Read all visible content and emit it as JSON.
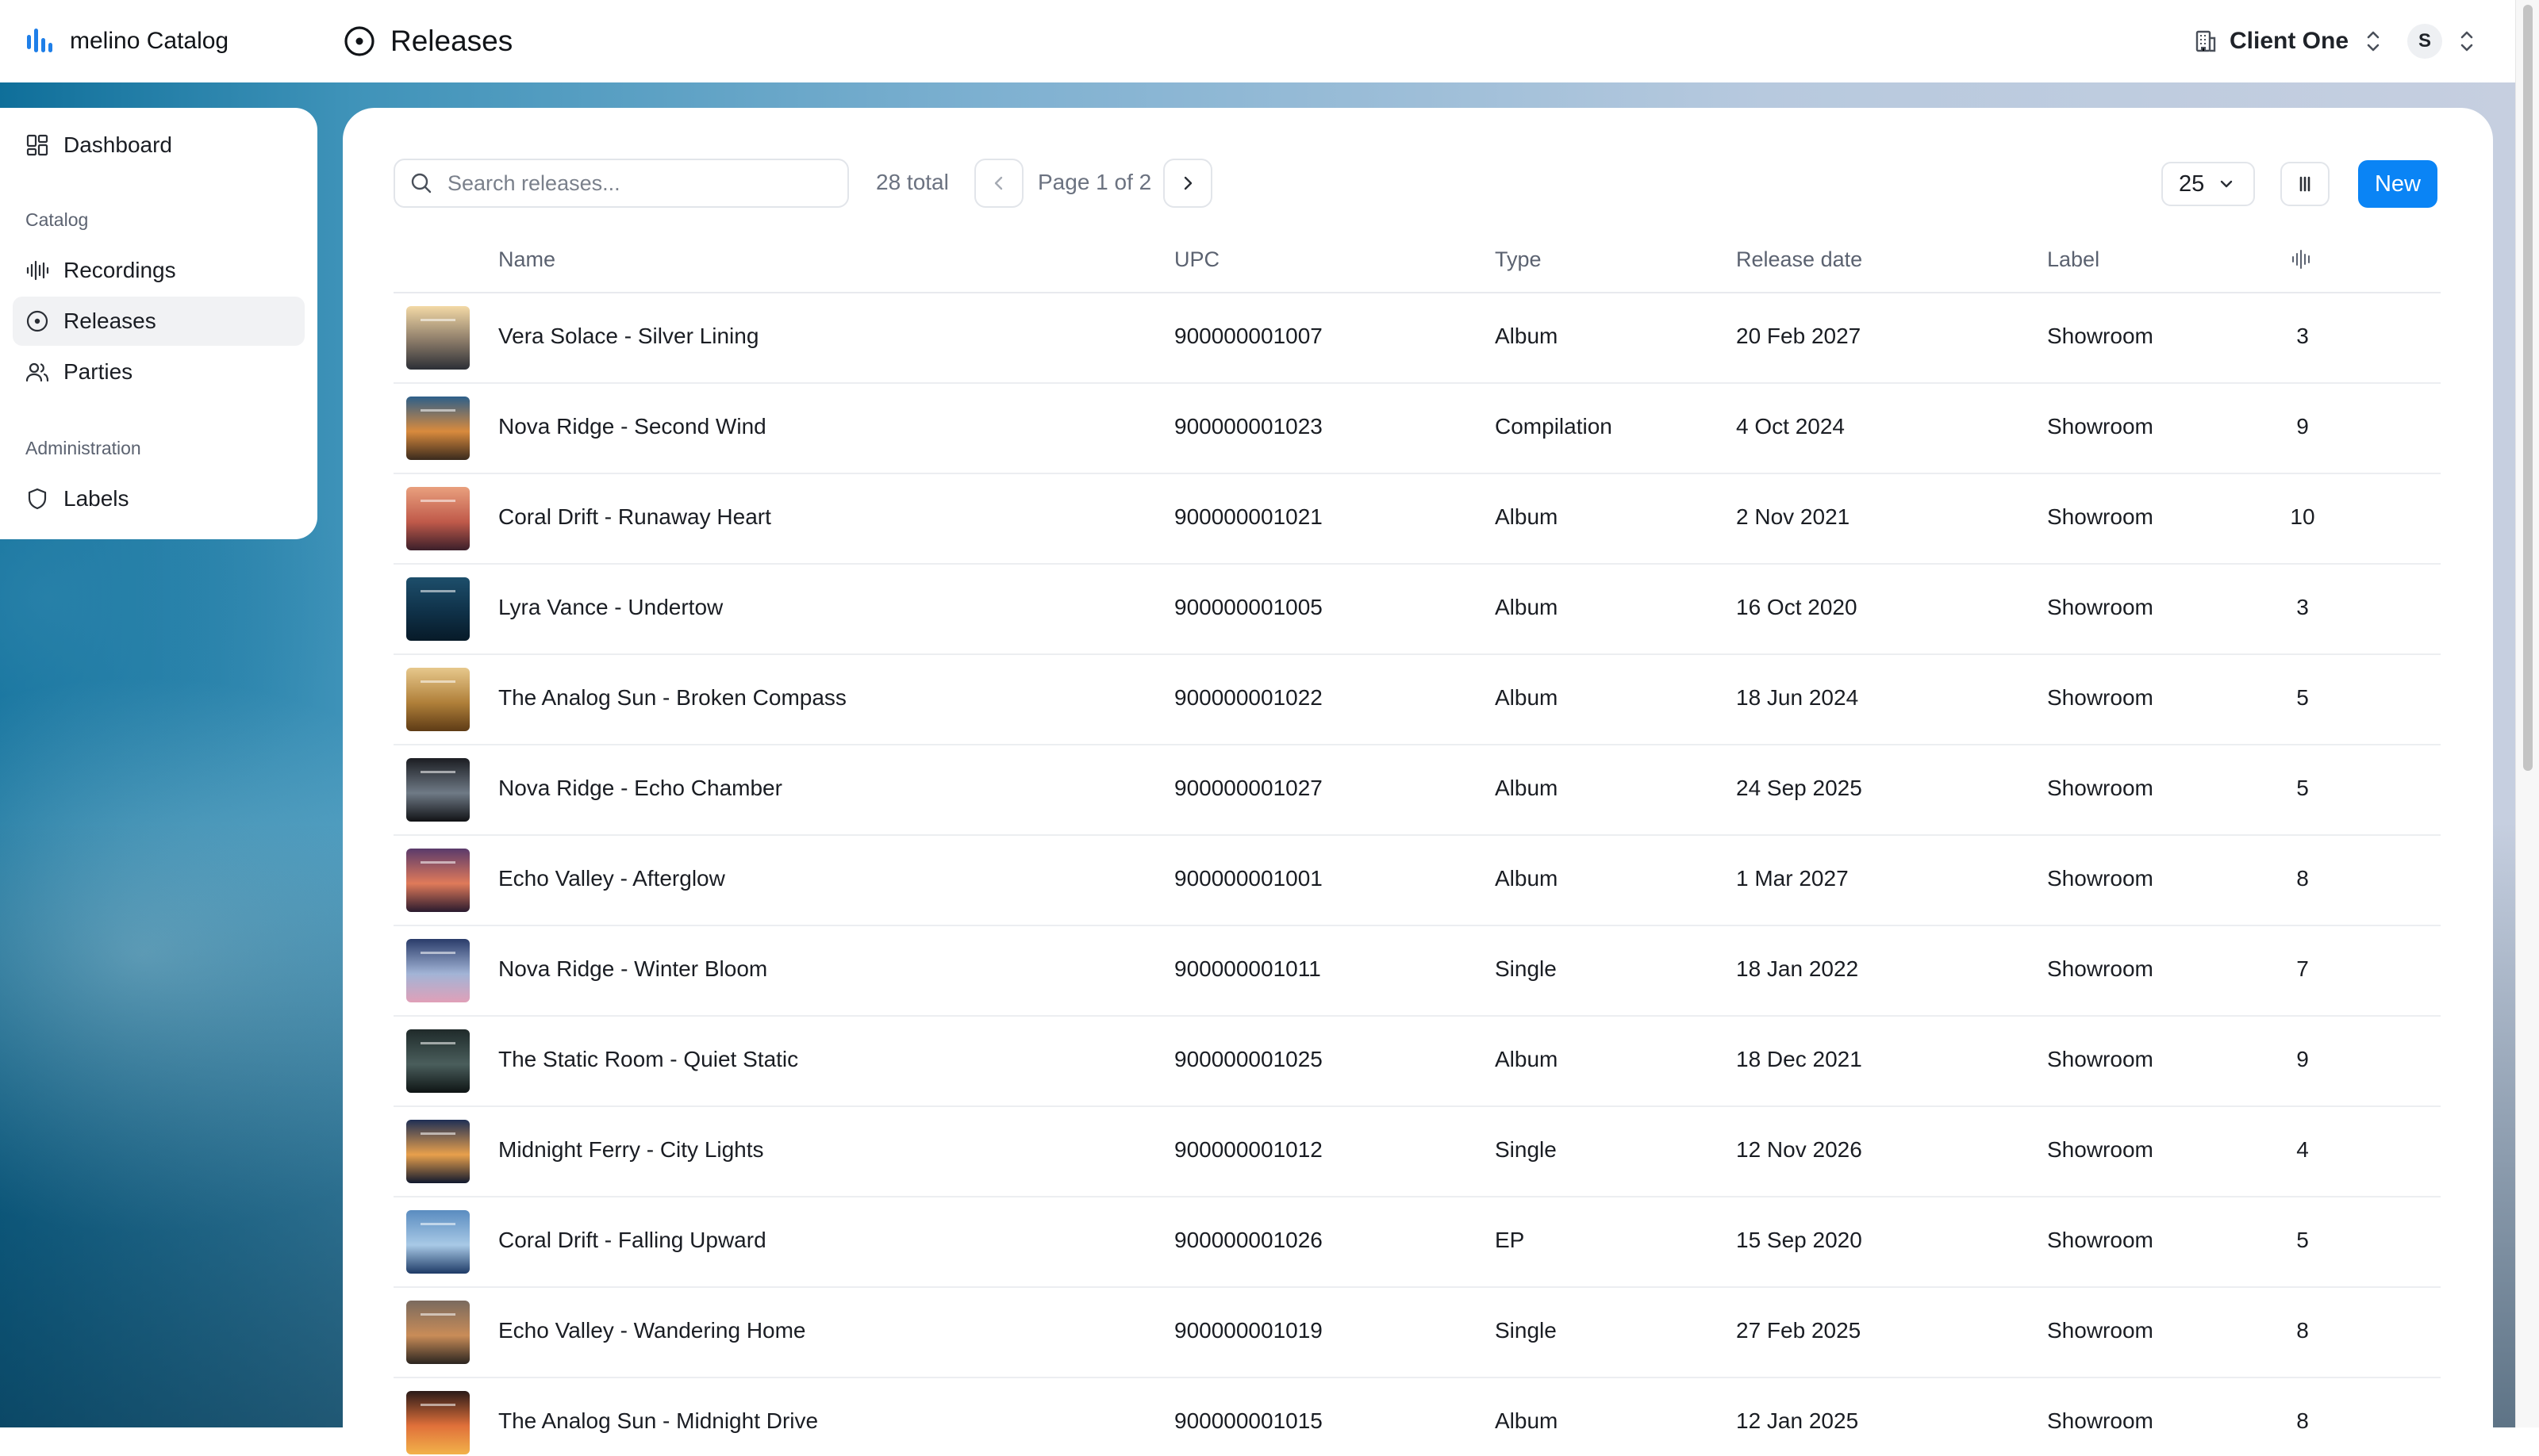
{
  "app": {
    "name": "melino Catalog",
    "page_title": "Releases"
  },
  "header": {
    "client_name": "Client One",
    "user_initial": "S"
  },
  "sidebar": {
    "items": [
      {
        "label": "Dashboard",
        "icon": "dashboard-icon"
      },
      {
        "label": "Recordings",
        "icon": "waveform-icon"
      },
      {
        "label": "Releases",
        "icon": "disc-icon",
        "active": true
      },
      {
        "label": "Parties",
        "icon": "users-icon"
      },
      {
        "label": "Labels",
        "icon": "shield-icon"
      }
    ],
    "sections": {
      "catalog": "Catalog",
      "administration": "Administration"
    }
  },
  "toolbar": {
    "search_placeholder": "Search releases...",
    "search_value": "",
    "total": "28 total",
    "page_info": "Page 1 of 2",
    "per_page": "25",
    "new_label": "New"
  },
  "table": {
    "columns": {
      "name": "Name",
      "upc": "UPC",
      "type": "Type",
      "release_date": "Release date",
      "label": "Label",
      "tracks_icon": "waveform-icon"
    },
    "rows": [
      {
        "name": "Vera Solace - Silver Lining",
        "upc": "900000001007",
        "type": "Album",
        "release_date": "20 Feb 2027",
        "label": "Showroom",
        "count": "3",
        "cover": [
          "#f3d9a6",
          "#8a7a68",
          "#2c2f36"
        ]
      },
      {
        "name": "Nova Ridge - Second Wind",
        "upc": "900000001023",
        "type": "Compilation",
        "release_date": "4 Oct 2024",
        "label": "Showroom",
        "count": "9",
        "cover": [
          "#2d5f8a",
          "#d98a3d",
          "#3a2a1d"
        ]
      },
      {
        "name": "Coral Drift - Runaway Heart",
        "upc": "900000001021",
        "type": "Album",
        "release_date": "2 Nov 2021",
        "label": "Showroom",
        "count": "10",
        "cover": [
          "#e9a07e",
          "#c05a4a",
          "#3b1f2a"
        ]
      },
      {
        "name": "Lyra Vance - Undertow",
        "upc": "900000001005",
        "type": "Album",
        "release_date": "16 Oct 2020",
        "label": "Showroom",
        "count": "3",
        "cover": [
          "#1d4e6b",
          "#0f3148",
          "#071a28"
        ]
      },
      {
        "name": "The Analog Sun - Broken Compass",
        "upc": "900000001022",
        "type": "Album",
        "release_date": "18 Jun 2024",
        "label": "Showroom",
        "count": "5",
        "cover": [
          "#e7c88c",
          "#b0803a",
          "#5e3b16"
        ]
      },
      {
        "name": "Nova Ridge - Echo Chamber",
        "upc": "900000001027",
        "type": "Album",
        "release_date": "24 Sep 2025",
        "label": "Showroom",
        "count": "5",
        "cover": [
          "#1b1d22",
          "#6f7a86",
          "#111215"
        ]
      },
      {
        "name": "Echo Valley - Afterglow",
        "upc": "900000001001",
        "type": "Album",
        "release_date": "1 Mar 2027",
        "label": "Showroom",
        "count": "8",
        "cover": [
          "#5a3a6b",
          "#e07a5a",
          "#2a1a2e"
        ]
      },
      {
        "name": "Nova Ridge - Winter Bloom",
        "upc": "900000001011",
        "type": "Single",
        "release_date": "18 Jan 2022",
        "label": "Showroom",
        "count": "7",
        "cover": [
          "#2a3c6a",
          "#a2b4d6",
          "#e0a0b8"
        ]
      },
      {
        "name": "The Static Room - Quiet Static",
        "upc": "900000001025",
        "type": "Album",
        "release_date": "18 Dec 2021",
        "label": "Showroom",
        "count": "9",
        "cover": [
          "#1f2a2a",
          "#4a5e5c",
          "#0e1414"
        ]
      },
      {
        "name": "Midnight Ferry - City Lights",
        "upc": "900000001012",
        "type": "Single",
        "release_date": "12 Nov 2026",
        "label": "Showroom",
        "count": "4",
        "cover": [
          "#1e2f55",
          "#e8a04c",
          "#10182e"
        ]
      },
      {
        "name": "Coral Drift - Falling Upward",
        "upc": "900000001026",
        "type": "EP",
        "release_date": "15 Sep 2020",
        "label": "Showroom",
        "count": "5",
        "cover": [
          "#5a8cc0",
          "#a8c9e6",
          "#1e3a66"
        ]
      },
      {
        "name": "Echo Valley - Wandering Home",
        "upc": "900000001019",
        "type": "Single",
        "release_date": "27 Feb 2025",
        "label": "Showroom",
        "count": "8",
        "cover": [
          "#7a6a5e",
          "#c98c58",
          "#2b2520"
        ]
      },
      {
        "name": "The Analog Sun - Midnight Drive",
        "upc": "900000001015",
        "type": "Album",
        "release_date": "12 Jan 2025",
        "label": "Showroom",
        "count": "8",
        "cover": [
          "#2a1a18",
          "#e0703a",
          "#f2b24a"
        ]
      }
    ]
  }
}
